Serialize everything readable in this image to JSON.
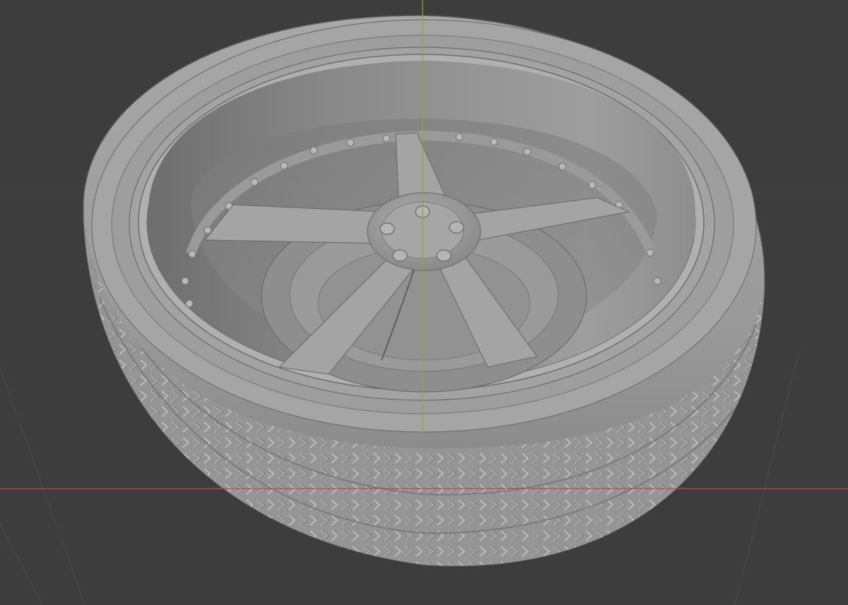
{
  "viewport": {
    "type": "3D viewport",
    "background_color": "#3d3d3d",
    "grid_line_color": "#4a4a4a",
    "x_axis_color": "#b84a55",
    "y_axis_color": "#8aa83a",
    "visible_axes": [
      "x-axis",
      "y-axis"
    ]
  },
  "model": {
    "name": "",
    "shading": "solid",
    "material_color": "#9c9c9c",
    "parts": [
      "tire",
      "tread",
      "rim",
      "rim-bolts",
      "spokes",
      "hub",
      "lug-nuts",
      "brake-disc"
    ],
    "spoke_count": 5,
    "lug_nut_count": 5
  }
}
